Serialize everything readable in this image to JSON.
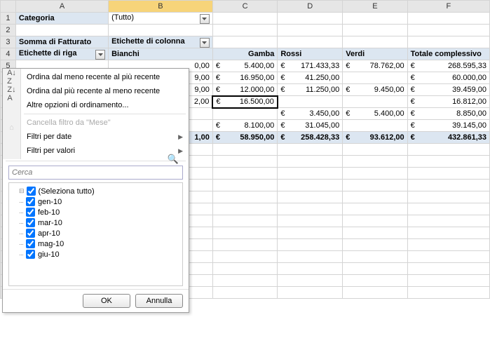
{
  "cols": [
    "A",
    "B",
    "C",
    "D",
    "E",
    "F"
  ],
  "r1": {
    "label": "Categoria",
    "val": "(Tutto)"
  },
  "r3": {
    "a": "Somma di Fatturato",
    "b": "Etichette di colonna"
  },
  "r4": {
    "a": "Etichette di riga",
    "b": "Bianchi",
    "c": "Gamba",
    "d": "Rossi",
    "e": "Verdi",
    "f": "Totale complessivo"
  },
  "rows": [
    {
      "end": "0,00",
      "c": "5.400,00",
      "d": "171.433,33",
      "e": "78.762,00",
      "f": "268.595,33"
    },
    {
      "end": "9,00",
      "c": "16.950,00",
      "d": "41.250,00",
      "e": "",
      "f": "60.000,00"
    },
    {
      "end": "9,00",
      "c": "12.000,00",
      "d": "11.250,00",
      "e": "9.450,00",
      "f": "39.459,00"
    },
    {
      "end": "2,00",
      "c": "16.500,00",
      "d": "",
      "e": "",
      "f": "16.812,00"
    },
    {
      "end": "",
      "c": "",
      "d": "3.450,00",
      "e": "5.400,00",
      "f": "8.850,00"
    },
    {
      "end": "",
      "c": "8.100,00",
      "d": "31.045,00",
      "e": "",
      "f": "39.145,00"
    }
  ],
  "total": {
    "end": "1,00",
    "c": "58.950,00",
    "d": "258.428,33",
    "e": "93.612,00",
    "f": "432.861,33"
  },
  "menu": {
    "sortAsc": "Ordina dal meno recente al più recente",
    "sortDesc": "Ordina dal più recente al meno recente",
    "moreSort": "Altre opzioni di ordinamento...",
    "clear": "Cancella filtro da \"Mese\"",
    "dateF": "Filtri per date",
    "valF": "Filtri per valori",
    "search": "Cerca",
    "selAll": "(Seleziona tutto)",
    "items": [
      "gen-10",
      "feb-10",
      "mar-10",
      "apr-10",
      "mag-10",
      "giu-10"
    ],
    "ok": "OK",
    "cancel": "Annulla"
  },
  "lastRow": "24",
  "eur": "€"
}
